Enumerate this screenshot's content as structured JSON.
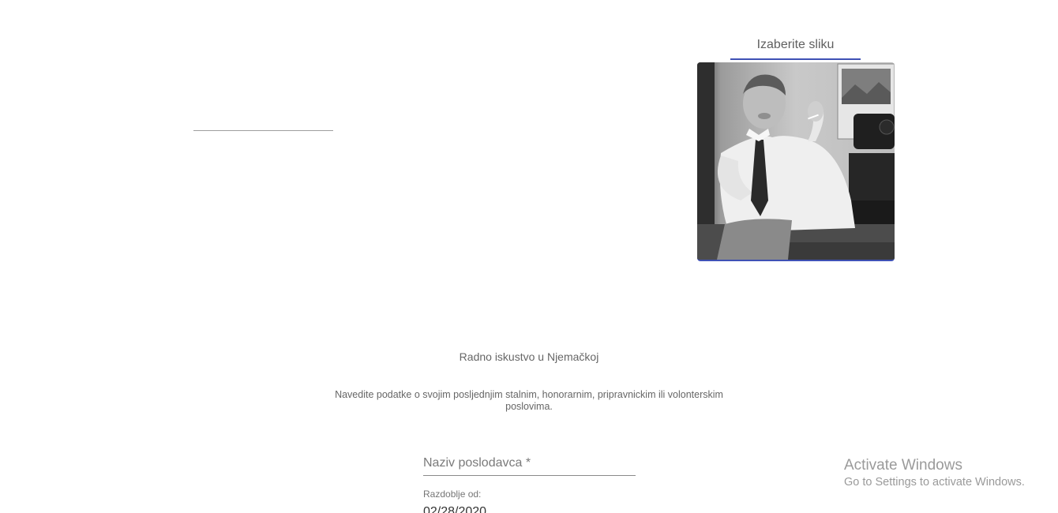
{
  "profile": {
    "image_picker_label": "Izaberite sliku",
    "accent_color": "#3f51b5"
  },
  "work_experience": {
    "title": "Radno iskustvo u Njemačkoj",
    "description": "Navedite podatke o svojim posljednjim stalnim, honorarnim, pripravnickim ili volonterskim poslovima.",
    "employer_field": {
      "placeholder": "Naziv poslodavca *",
      "value": ""
    },
    "period_from": {
      "label": "Razdoblje od:",
      "value": "02/28/2020"
    }
  },
  "watermark": {
    "title": "Activate Windows",
    "subtitle": "Go to Settings to activate Windows."
  }
}
